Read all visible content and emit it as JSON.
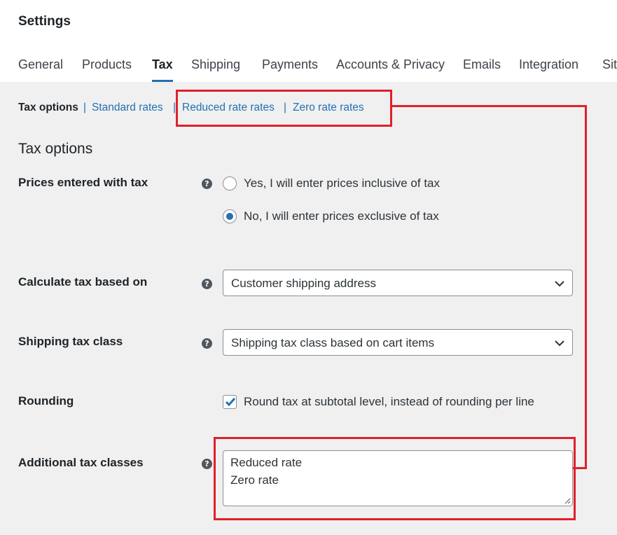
{
  "header": {
    "title": "Settings",
    "tabs": [
      {
        "label": "General"
      },
      {
        "label": "Products"
      },
      {
        "label": "Tax"
      },
      {
        "label": "Shipping"
      },
      {
        "label": "Payments"
      },
      {
        "label": "Accounts & Privacy"
      },
      {
        "label": "Emails"
      },
      {
        "label": "Integration"
      },
      {
        "label": "Sit"
      }
    ],
    "active_tab": "Tax"
  },
  "subnav": {
    "items": [
      {
        "label": "Tax options"
      },
      {
        "label": "Standard rates"
      },
      {
        "label": "Reduced rate rates"
      },
      {
        "label": "Zero rate rates"
      }
    ],
    "separator": "|"
  },
  "section": {
    "title": "Tax options"
  },
  "fields": {
    "prices": {
      "label": "Prices entered with tax",
      "options": [
        {
          "label": "Yes, I will enter prices inclusive of tax",
          "checked": false
        },
        {
          "label": "No, I will enter prices exclusive of tax",
          "checked": true
        }
      ]
    },
    "calc_based_on": {
      "label": "Calculate tax based on",
      "value": "Customer shipping address"
    },
    "shipping_class": {
      "label": "Shipping tax class",
      "value": "Shipping tax class based on cart items"
    },
    "rounding": {
      "label": "Rounding",
      "checkbox_label": "Round tax at subtotal level, instead of rounding per line",
      "checked": true
    },
    "additional_classes": {
      "label": "Additional tax classes",
      "value": "Reduced rate\nZero rate"
    }
  },
  "icons": {
    "help": "?",
    "help_icon": "question-circle-icon",
    "select_icon": "chevron-down-icon",
    "check_icon": "checkmark-icon"
  },
  "colors": {
    "accent": "#2271b1",
    "annotation": "#e0202a",
    "background": "#f0f0f1"
  }
}
